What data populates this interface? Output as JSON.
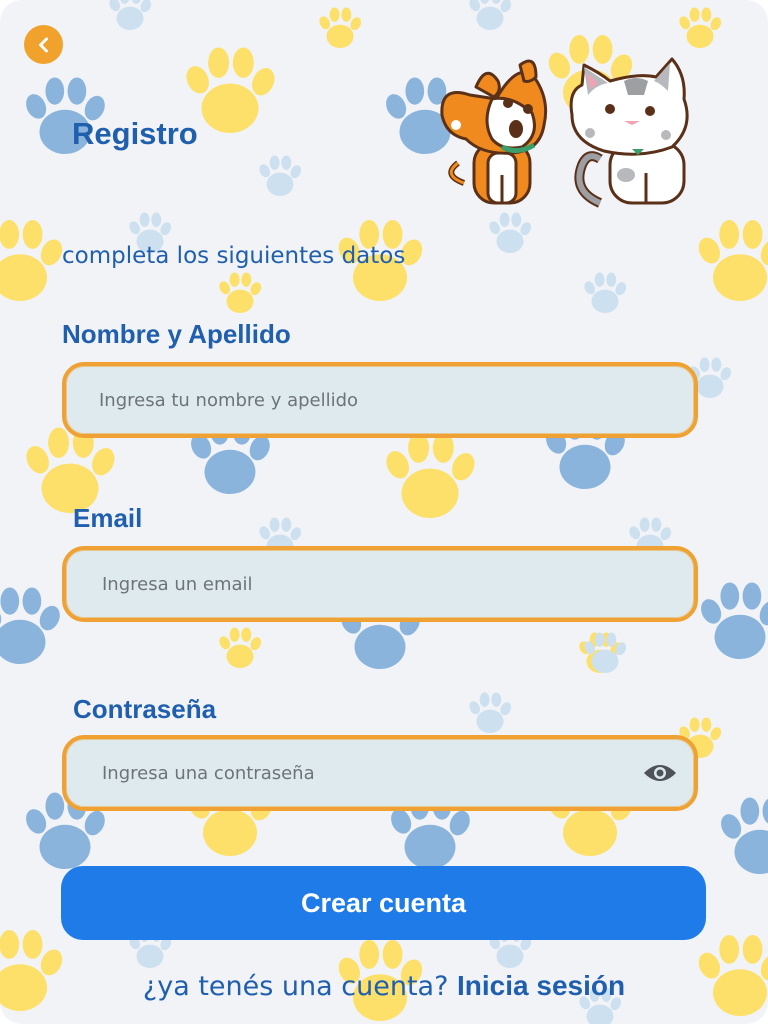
{
  "header": {
    "back_icon": "chevron-left-icon",
    "title": "Registro",
    "illustration": "dog-and-cat-illustration"
  },
  "form": {
    "subtitle": "completa los siguientes datos",
    "name": {
      "label": "Nombre y Apellido",
      "placeholder": "Ingresa tu nombre y apellido",
      "value": ""
    },
    "email": {
      "label": "Email",
      "placeholder": "Ingresa un email",
      "value": ""
    },
    "password": {
      "label": "Contraseña",
      "placeholder": "Ingresa una contraseña",
      "value": "",
      "toggle_icon": "eye-icon"
    },
    "submit_label": "Crear cuenta"
  },
  "footer": {
    "prompt": "¿ya tenés una cuenta?",
    "link": "Inicia sesión"
  },
  "colors": {
    "primary_blue": "#1f7be8",
    "text_blue": "#1f5fae",
    "accent_orange": "#efa233",
    "field_bg": "#dfeaee",
    "background": "#f1f3f6",
    "paw_yellow": "#fde06a",
    "paw_blue": "#8ab4dc"
  }
}
